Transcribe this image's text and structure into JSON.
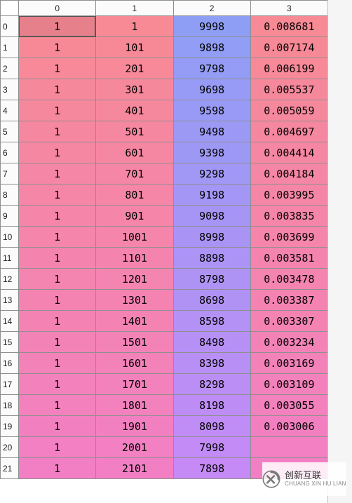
{
  "columns": [
    "0",
    "1",
    "2",
    "3"
  ],
  "row_indices": [
    "0",
    "1",
    "2",
    "3",
    "4",
    "5",
    "6",
    "7",
    "8",
    "9",
    "10",
    "11",
    "12",
    "13",
    "14",
    "15",
    "16",
    "17",
    "18",
    "19",
    "20",
    "21"
  ],
  "selected_row": 0,
  "selected_col": 0,
  "rows": [
    {
      "c0": "1",
      "c1": "1",
      "c2": "9998",
      "c3": "0.008681"
    },
    {
      "c0": "1",
      "c1": "101",
      "c2": "9898",
      "c3": "0.007174"
    },
    {
      "c0": "1",
      "c1": "201",
      "c2": "9798",
      "c3": "0.006199"
    },
    {
      "c0": "1",
      "c1": "301",
      "c2": "9698",
      "c3": "0.005537"
    },
    {
      "c0": "1",
      "c1": "401",
      "c2": "9598",
      "c3": "0.005059"
    },
    {
      "c0": "1",
      "c1": "501",
      "c2": "9498",
      "c3": "0.004697"
    },
    {
      "c0": "1",
      "c1": "601",
      "c2": "9398",
      "c3": "0.004414"
    },
    {
      "c0": "1",
      "c1": "701",
      "c2": "9298",
      "c3": "0.004184"
    },
    {
      "c0": "1",
      "c1": "801",
      "c2": "9198",
      "c3": "0.003995"
    },
    {
      "c0": "1",
      "c1": "901",
      "c2": "9098",
      "c3": "0.003835"
    },
    {
      "c0": "1",
      "c1": "1001",
      "c2": "8998",
      "c3": "0.003699"
    },
    {
      "c0": "1",
      "c1": "1101",
      "c2": "8898",
      "c3": "0.003581"
    },
    {
      "c0": "1",
      "c1": "1201",
      "c2": "8798",
      "c3": "0.003478"
    },
    {
      "c0": "1",
      "c1": "1301",
      "c2": "8698",
      "c3": "0.003387"
    },
    {
      "c0": "1",
      "c1": "1401",
      "c2": "8598",
      "c3": "0.003307"
    },
    {
      "c0": "1",
      "c1": "1501",
      "c2": "8498",
      "c3": "0.003234"
    },
    {
      "c0": "1",
      "c1": "1601",
      "c2": "8398",
      "c3": "0.003169"
    },
    {
      "c0": "1",
      "c1": "1701",
      "c2": "8298",
      "c3": "0.003109"
    },
    {
      "c0": "1",
      "c1": "1801",
      "c2": "8198",
      "c3": "0.003055"
    },
    {
      "c0": "1",
      "c1": "1901",
      "c2": "8098",
      "c3": "0.003006"
    },
    {
      "c0": "1",
      "c1": "2001",
      "c2": "7998",
      "c3": ""
    },
    {
      "c0": "1",
      "c1": "2101",
      "c2": "7898",
      "c3": ""
    }
  ],
  "colors": {
    "pink_start": "#f78a95",
    "pink_end": "#f27fc4",
    "blue_start": "#8f9ef5",
    "blue_end": "#c58af5",
    "header_bg": "#fbfbfb"
  },
  "watermark": {
    "cn": "创新互联",
    "en": "CHUANG XIN HU LIAN"
  }
}
